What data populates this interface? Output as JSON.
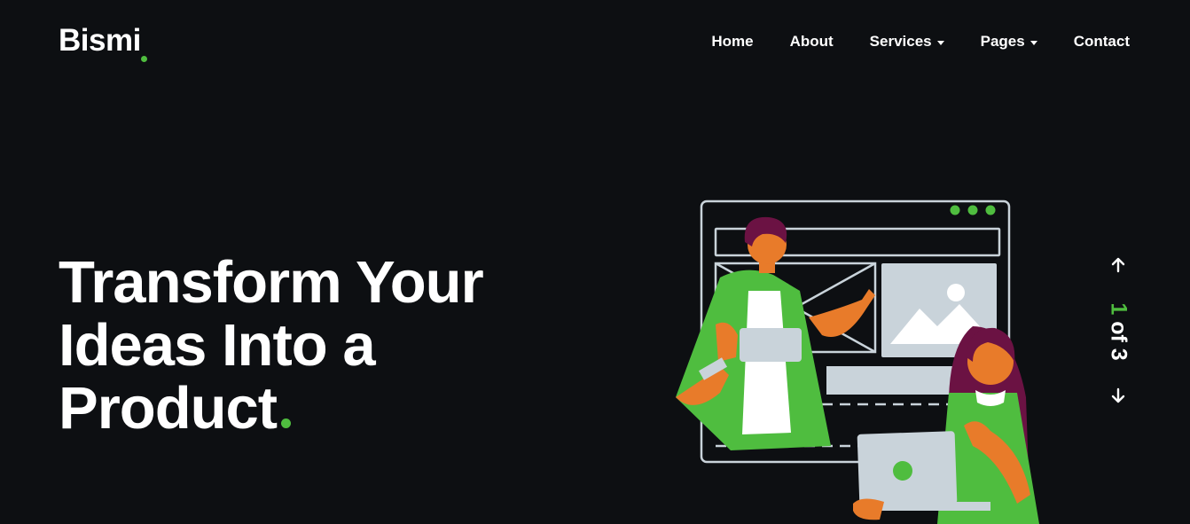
{
  "brand": {
    "name": "Bismi",
    "accent_color": "#4fbd3f"
  },
  "nav": {
    "items": [
      {
        "label": "Home",
        "has_dropdown": false
      },
      {
        "label": "About",
        "has_dropdown": false
      },
      {
        "label": "Services",
        "has_dropdown": true
      },
      {
        "label": "Pages",
        "has_dropdown": true
      },
      {
        "label": "Contact",
        "has_dropdown": false
      }
    ]
  },
  "hero": {
    "title_line1": "Transform Your",
    "title_line2": "Ideas Into a",
    "title_line3": "Product"
  },
  "slider": {
    "current": "1",
    "separator": "of",
    "total": "3",
    "prev_icon": "arrow-up-icon",
    "next_icon": "arrow-down-icon"
  },
  "colors": {
    "background": "#0d0f12",
    "text": "#ffffff",
    "accent": "#4fbd3f",
    "illustration_orange": "#e87b2a",
    "illustration_purple": "#6b1243",
    "illustration_grey": "#c9d3da"
  }
}
